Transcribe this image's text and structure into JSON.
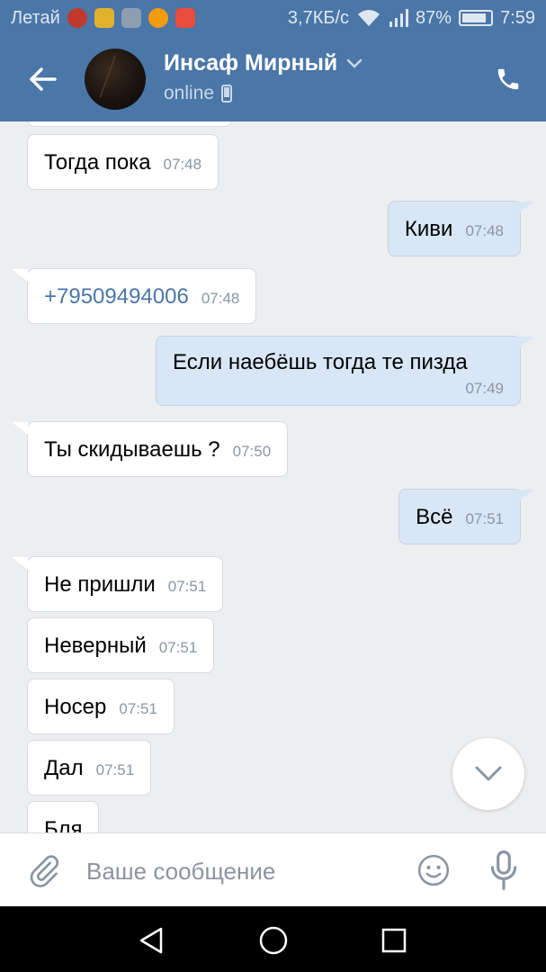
{
  "status_bar": {
    "carrier": "Летай",
    "speed": "3,7КБ/с",
    "battery": "87%",
    "battery_level": 0.87,
    "time": "7:59"
  },
  "header": {
    "contact_name": "Инсаф Мирный",
    "status": "online",
    "icons": {
      "back": "arrow-left-icon",
      "call": "phone-icon",
      "dropdown": "chevron-down-icon",
      "device": "mobile-device-icon"
    }
  },
  "messages": [
    {
      "direction": "in",
      "text": "Тогда пока",
      "time": "07:48"
    },
    {
      "direction": "out",
      "text": "Киви",
      "time": "07:48"
    },
    {
      "direction": "in",
      "text": "+79509494006",
      "time": "07:48",
      "is_link": true
    },
    {
      "direction": "out",
      "text": "Если наебёшь тогда те пизда",
      "time": "07:49"
    },
    {
      "direction": "in",
      "text": "Ты скидываешь ?",
      "time": "07:50"
    },
    {
      "direction": "out",
      "text": "Всё",
      "time": "07:51"
    },
    {
      "direction": "in",
      "text": "Не пришли",
      "time": "07:51"
    },
    {
      "direction": "in",
      "text": "Неверный",
      "time": "07:51"
    },
    {
      "direction": "in",
      "text": "Носер",
      "time": "07:51"
    },
    {
      "direction": "in",
      "text": "Дал",
      "time": "07:51"
    },
    {
      "direction": "in",
      "text": "Бля",
      "time": ""
    }
  ],
  "input": {
    "placeholder": "Ваше сообщение",
    "value": ""
  },
  "colors": {
    "header_bg": "#4a76a8",
    "chat_bg": "#edeef0",
    "outgoing_bubble": "#d8e6f5",
    "incoming_bubble": "#ffffff",
    "link": "#4a76a8"
  }
}
